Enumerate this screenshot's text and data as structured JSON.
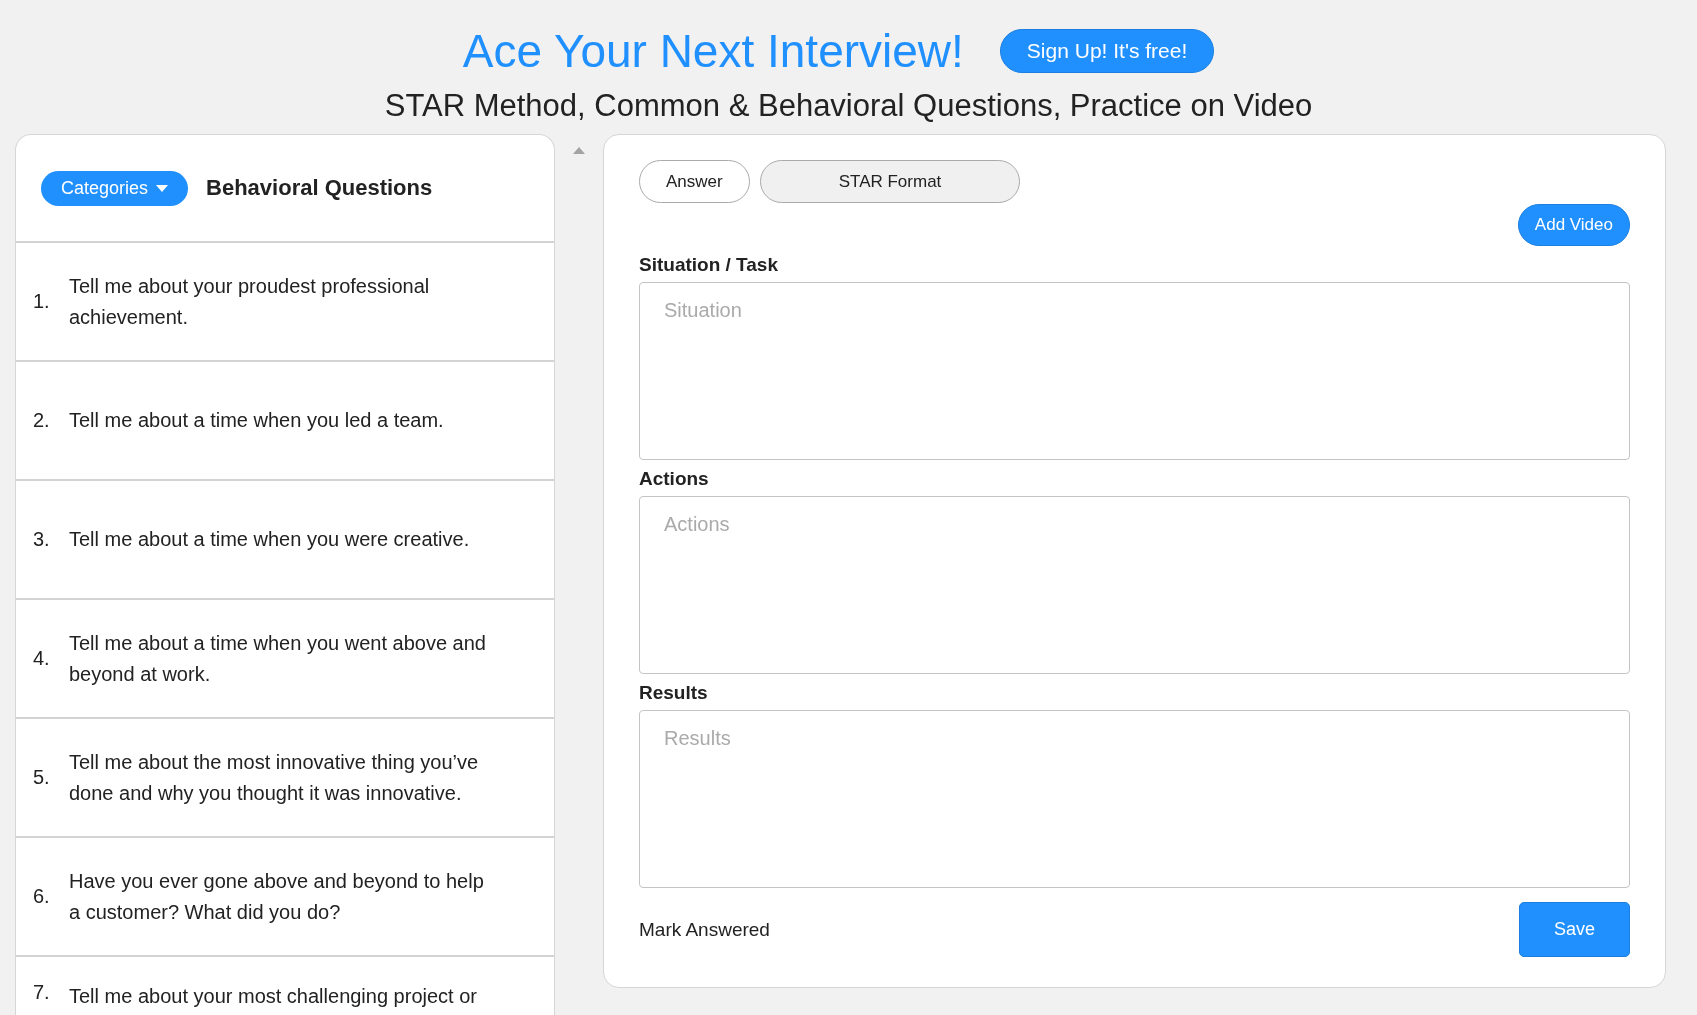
{
  "header": {
    "title": "Ace Your Next Interview!",
    "signup_button": "Sign Up! It's free!",
    "subtitle": "STAR Method, Common & Behavioral Questions, Practice on Video"
  },
  "sidebar": {
    "categories_button": "Categories",
    "heading": "Behavioral Questions",
    "questions": [
      {
        "number": "1.",
        "text": "Tell me about your proudest professional achievement."
      },
      {
        "number": "2.",
        "text": "Tell me about a time when you led a team."
      },
      {
        "number": "3.",
        "text": "Tell me about a time when you were creative."
      },
      {
        "number": "4.",
        "text": "Tell me about a time when you went above and beyond at work."
      },
      {
        "number": "5.",
        "text": "Tell me about the most innovative thing you’ve done and why you thought it was innovative."
      },
      {
        "number": "6.",
        "text": "Have you ever gone above and beyond to help a customer? What did you do?"
      },
      {
        "number": "7.",
        "text": "Tell me about your most challenging project or"
      }
    ]
  },
  "editor": {
    "tabs": [
      {
        "label": "Answer",
        "selected": false
      },
      {
        "label": "STAR Format",
        "selected": true
      }
    ],
    "add_video_button": "Add Video",
    "fields": [
      {
        "label": "Situation / Task",
        "placeholder": "Situation"
      },
      {
        "label": "Actions",
        "placeholder": "Actions"
      },
      {
        "label": "Results",
        "placeholder": "Results"
      }
    ],
    "mark_answered": "Mark Answered",
    "save_button": "Save"
  }
}
